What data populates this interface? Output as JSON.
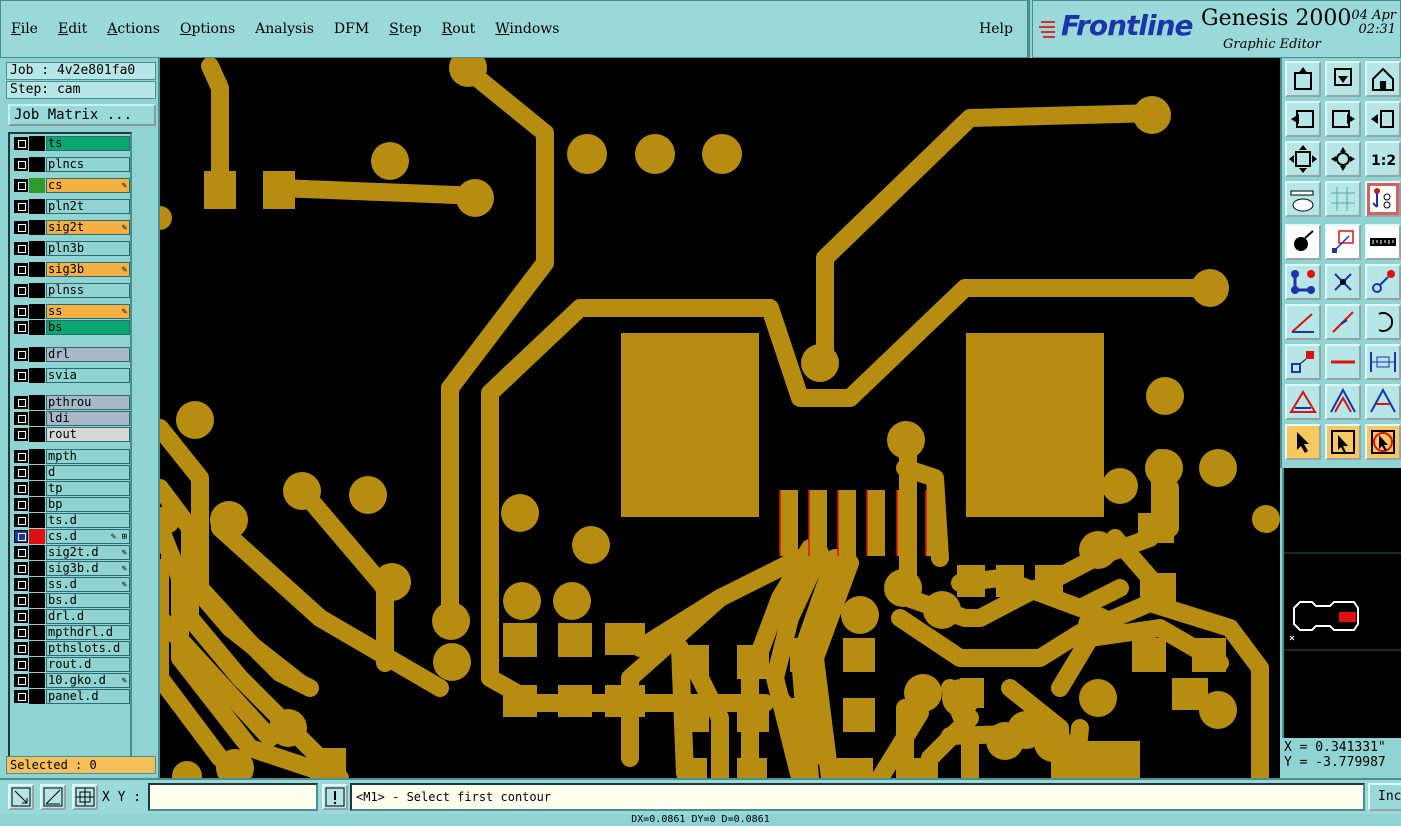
{
  "menu": {
    "items": [
      "File",
      "Edit",
      "Actions",
      "Options",
      "Analysis",
      "DFM",
      "Step",
      "Rout",
      "Windows"
    ],
    "help": "Help"
  },
  "brand": {
    "logo": "Frontline",
    "product": "Genesis 2000",
    "subtitle": "Graphic Editor",
    "date": "04 Apr",
    "time": "02:31"
  },
  "job": {
    "label": "Job : 4v2e801fa0",
    "step": "Step: cam",
    "matrix_button": "Job Matrix ..."
  },
  "layers": [
    {
      "name": "ts",
      "bg": "#0aa870",
      "swatch": "#000",
      "flag": ""
    },
    {
      "name": "plncs",
      "bg": "#8fd3d3",
      "swatch": "#000",
      "flag": ""
    },
    {
      "name": "cs",
      "bg": "#f5b043",
      "swatch": "#2f9b2f",
      "flag": "✎"
    },
    {
      "name": "pln2t",
      "bg": "#8fd3d3",
      "swatch": "#000",
      "flag": ""
    },
    {
      "name": "sig2t",
      "bg": "#f5b043",
      "swatch": "#000",
      "flag": "✎"
    },
    {
      "name": "pln3b",
      "bg": "#8fd3d3",
      "swatch": "#000",
      "flag": ""
    },
    {
      "name": "sig3b",
      "bg": "#f5b043",
      "swatch": "#000",
      "flag": "✎"
    },
    {
      "name": "plnss",
      "bg": "#8fd3d3",
      "swatch": "#000",
      "flag": ""
    },
    {
      "name": "ss",
      "bg": "#f5b043",
      "swatch": "#000",
      "flag": "✎"
    },
    {
      "name": "bs",
      "bg": "#0aa870",
      "swatch": "#000",
      "flag": ""
    },
    {
      "name": "drl",
      "bg": "#a8b8c8",
      "swatch": "#000",
      "flag": ""
    },
    {
      "name": "svia",
      "bg": "#8fd3d3",
      "swatch": "#000",
      "flag": ""
    },
    {
      "name": "pthrou",
      "bg": "#a8b8c8",
      "swatch": "#000",
      "flag": ""
    },
    {
      "name": "ldi",
      "bg": "#a8b8c8",
      "swatch": "#000",
      "flag": ""
    },
    {
      "name": "rout",
      "bg": "#d8d8d8",
      "swatch": "#000",
      "flag": ""
    },
    {
      "name": "mpth",
      "bg": "#8fd3d3",
      "swatch": "#000",
      "flag": ""
    },
    {
      "name": "d",
      "bg": "#8fd3d3",
      "swatch": "#000",
      "flag": ""
    },
    {
      "name": "tp",
      "bg": "#8fd3d3",
      "swatch": "#000",
      "flag": ""
    },
    {
      "name": "bp",
      "bg": "#8fd3d3",
      "swatch": "#000",
      "flag": ""
    },
    {
      "name": "ts.d",
      "bg": "#8fd3d3",
      "swatch": "#000",
      "flag": ""
    },
    {
      "name": "cs.d",
      "bg": "#8fd3d3",
      "swatch": "#e01010",
      "flag": "✎ ⊞"
    },
    {
      "name": "sig2t.d",
      "bg": "#8fd3d3",
      "swatch": "#000",
      "flag": "✎"
    },
    {
      "name": "sig3b.d",
      "bg": "#8fd3d3",
      "swatch": "#000",
      "flag": "✎"
    },
    {
      "name": "ss.d",
      "bg": "#8fd3d3",
      "swatch": "#000",
      "flag": "✎"
    },
    {
      "name": "bs.d",
      "bg": "#8fd3d3",
      "swatch": "#000",
      "flag": ""
    },
    {
      "name": "drl.d",
      "bg": "#8fd3d3",
      "swatch": "#000",
      "flag": ""
    },
    {
      "name": "mpthdrl.d",
      "bg": "#8fd3d3",
      "swatch": "#000",
      "flag": ""
    },
    {
      "name": "pthslots.d",
      "bg": "#8fd3d3",
      "swatch": "#000",
      "flag": ""
    },
    {
      "name": "rout.d",
      "bg": "#8fd3d3",
      "swatch": "#000",
      "flag": ""
    },
    {
      "name": "10.gko.d",
      "bg": "#8fd3d3",
      "swatch": "#000",
      "flag": "✎"
    },
    {
      "name": "panel.d",
      "bg": "#8fd3d3",
      "swatch": "#000",
      "flag": ""
    }
  ],
  "selected": "Selected : 0",
  "coords": {
    "x": "X = 0.341331\"",
    "y": "Y = -3.779987"
  },
  "bottom": {
    "xy_label": "X Y :",
    "xy_value": "",
    "message": "<M1> - Select first contour",
    "inc_label": "Inc"
  },
  "status": "DX=0.0861 DY=0 D=0.0861",
  "colors": {
    "copper": "#b68d10",
    "canvas": "#000000",
    "panel": "#8fd3d3"
  }
}
